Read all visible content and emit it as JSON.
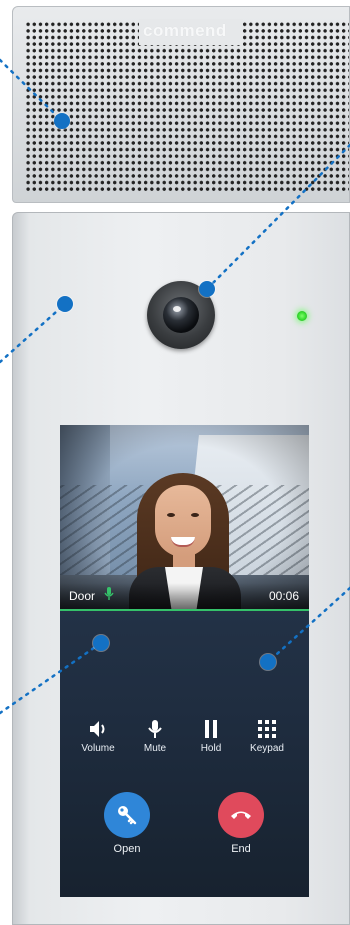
{
  "device": {
    "brand": "commend",
    "led_color": "#35d42f"
  },
  "screen": {
    "video": {
      "source_label": "Door",
      "timer": "00:06",
      "progress_color": "#35c26a"
    },
    "controls": [
      {
        "label": "Volume",
        "icon": "speaker-icon"
      },
      {
        "label": "Mute",
        "icon": "microphone-icon"
      },
      {
        "label": "Hold",
        "icon": "pause-icon"
      },
      {
        "label": "Keypad",
        "icon": "keypad-icon"
      }
    ],
    "actions": {
      "open": {
        "label": "Open",
        "icon": "key-icon",
        "color": "#2f86d8"
      },
      "end": {
        "label": "End",
        "icon": "hang-up-icon",
        "color": "#e04a5c"
      }
    }
  },
  "callouts": {
    "color": "#1371c4",
    "count": 5
  }
}
